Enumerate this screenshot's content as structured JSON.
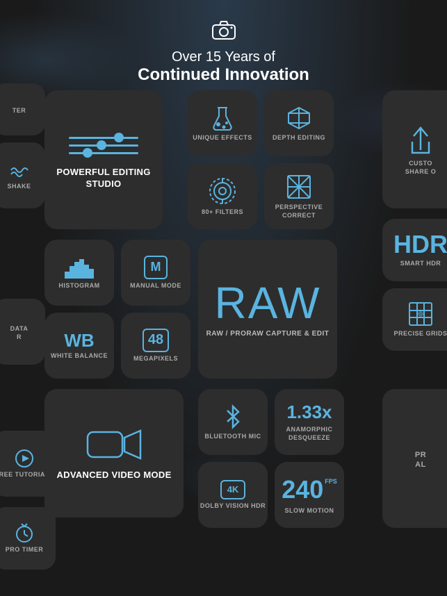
{
  "header": {
    "camera_icon": "📷",
    "subtitle": "Over 15 Years of",
    "title": "Continued Innovation"
  },
  "tiles": {
    "editing": {
      "label": "POWERFUL\nEDITING STUDIO"
    },
    "unique": {
      "label": "UNIQUE\nEFFECTS"
    },
    "depth": {
      "label": "DEPTH\nEDITING"
    },
    "custom": {
      "label": "CUSTO\nSHARE O"
    },
    "filters": {
      "label": "80+ FILTERS"
    },
    "perspective": {
      "label": "PERSPECTIVE\nCORRECT"
    },
    "histogram": {
      "label": "HISTOGRAM"
    },
    "manual": {
      "label": "MANUAL MODE"
    },
    "raw": {
      "big": "RAW",
      "label": "RAW / PRORAW\nCAPTURE & EDIT"
    },
    "hdr": {
      "big": "HDR",
      "label": "SMART HDR"
    },
    "grids": {
      "label": "PRECISE\nGRIDS"
    },
    "wb": {
      "big": "WB",
      "label": "WHITE\nBALANCE"
    },
    "megapixels": {
      "big": "48",
      "label": "MEGAPIXELS"
    },
    "data": {
      "label": "DATA\nR"
    },
    "shake": {
      "label": "SHAKE"
    },
    "tutorials": {
      "label": "FREE\nTUTORIALS"
    },
    "video": {
      "label": "ADVANCED\nVIDEO MODE"
    },
    "bluetooth": {
      "label": "BLUETOOTH\nMIC"
    },
    "anamorphic": {
      "big": "1.33x",
      "label": "ANAMORPHIC\nDESQUEEZE"
    },
    "dolby": {
      "label": "DOLBY VISION\nHDR"
    },
    "slowmo": {
      "big": "240",
      "fps": "FPS",
      "label": "SLOW MOTION"
    },
    "proal": {
      "label": "PR\nAL"
    },
    "protimer": {
      "label": "PRO TIMER"
    }
  },
  "colors": {
    "accent": "#5ab4e0",
    "tile_bg": "#2d2d2d",
    "text_primary": "#ffffff",
    "text_secondary": "#aaaaaa"
  }
}
